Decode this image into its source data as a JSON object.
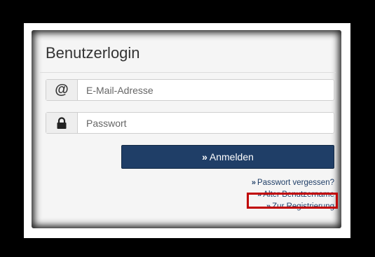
{
  "login": {
    "title": "Benutzerlogin",
    "email_icon": "@",
    "email_placeholder": "E-Mail-Adresse",
    "password_placeholder": "Passwort",
    "submit_label": "Anmelden",
    "chevron": "»"
  },
  "links": [
    {
      "label": "Passwort vergessen?"
    },
    {
      "label": "Alter Benutzername"
    },
    {
      "label": "Zur Registrierung"
    }
  ],
  "colors": {
    "primary": "#1f3e67",
    "highlight": "#c00000"
  },
  "icons": {
    "email": "at-icon",
    "password": "lock-icon",
    "chevron": "double-chevron-right-icon"
  }
}
